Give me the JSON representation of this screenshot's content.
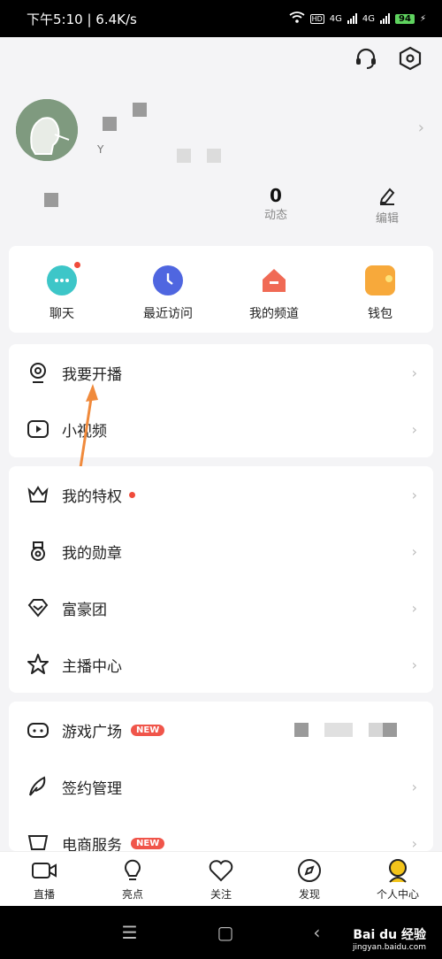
{
  "status": {
    "time_speed": "下午5:10 | 6.4K/s",
    "battery": "94",
    "net1": "4G",
    "net2": "4G",
    "hd": "HD"
  },
  "header": {
    "icons": [
      "headset-icon",
      "settings-hexagon-icon"
    ]
  },
  "profile": {
    "name_redacted": true,
    "sub": "Y"
  },
  "stats": {
    "dynamic_count": "0",
    "dynamic_label": "动态",
    "edit_label": "编辑"
  },
  "quick": [
    {
      "label": "聊天",
      "icon": "chat-icon",
      "color": "#3dc6c8"
    },
    {
      "label": "最近访问",
      "icon": "clock-icon",
      "color": "#4f66e0"
    },
    {
      "label": "我的频道",
      "icon": "channel-house-icon",
      "color": "#f06a55"
    },
    {
      "label": "钱包",
      "icon": "wallet-icon",
      "color": "#f7a93b"
    }
  ],
  "group1": [
    {
      "label": "我要开播",
      "icon": "camera-live-icon"
    },
    {
      "label": "小视频",
      "icon": "play-video-icon"
    }
  ],
  "group2": [
    {
      "label": "我的特权",
      "icon": "crown-icon"
    },
    {
      "label": "我的勋章",
      "icon": "medal-icon"
    },
    {
      "label": "富豪团",
      "icon": "diamond-icon"
    },
    {
      "label": "主播中心",
      "icon": "star-icon"
    }
  ],
  "group3": [
    {
      "label": "游戏广场",
      "badge": "NEW",
      "icon": "gamepad-icon"
    },
    {
      "label": "签约管理",
      "icon": "feather-icon"
    },
    {
      "label": "电商服务",
      "badge": "NEW",
      "icon": "cart-icon"
    }
  ],
  "tabs": [
    {
      "label": "直播",
      "icon": "video-camera-icon"
    },
    {
      "label": "亮点",
      "icon": "bulb-icon"
    },
    {
      "label": "关注",
      "icon": "heart-icon"
    },
    {
      "label": "发现",
      "icon": "compass-icon"
    },
    {
      "label": "个人中心",
      "icon": "person-icon",
      "active_color": "#f3c41b"
    }
  ],
  "watermark": {
    "brand": "Bai du 经验",
    "url": "jingyan.baidu.com"
  }
}
